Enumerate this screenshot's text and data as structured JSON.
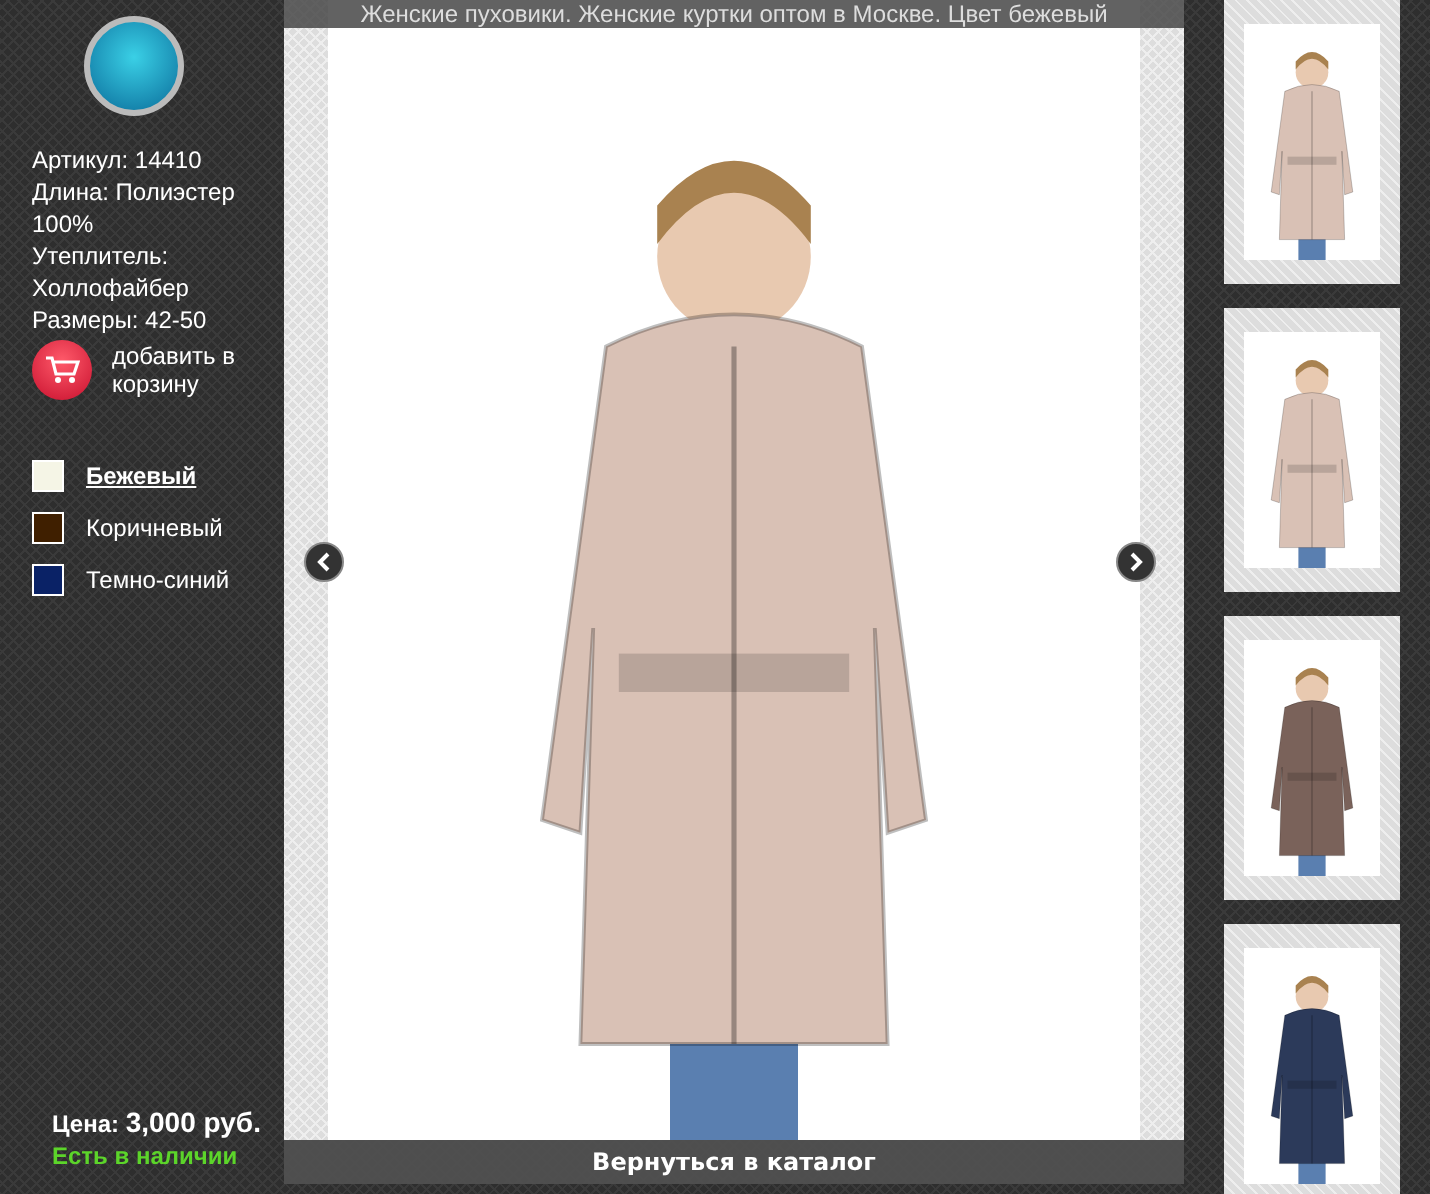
{
  "caption": "Женские пуховики. Женские куртки оптом в Москве. Цвет бежевый",
  "details": [
    "Артикул: 14410",
    "Длина: Полиэстер 100%",
    "Утеплитель: Холлофайбер",
    "Размеры: 42-50"
  ],
  "cart_button": {
    "label": "добавить в корзину"
  },
  "colors": [
    {
      "name": "Бежевый",
      "color": "#f5f5e6",
      "selected": true
    },
    {
      "name": "Коричневый",
      "color": "#3f1f00",
      "selected": false
    },
    {
      "name": "Темно-синий",
      "color": "#0a2266",
      "selected": false
    }
  ],
  "price": {
    "label": "Цена:",
    "value": "3,000 руб."
  },
  "availability": "Есть в наличии",
  "back_link": "Вернуться в каталог",
  "photo": {
    "color": "#d9c1b5"
  },
  "thumbnails": [
    {
      "color": "#d9c1b5"
    },
    {
      "color": "#d9c1b5"
    },
    {
      "color": "#7a625a"
    },
    {
      "color": "#2c3a5a"
    }
  ]
}
